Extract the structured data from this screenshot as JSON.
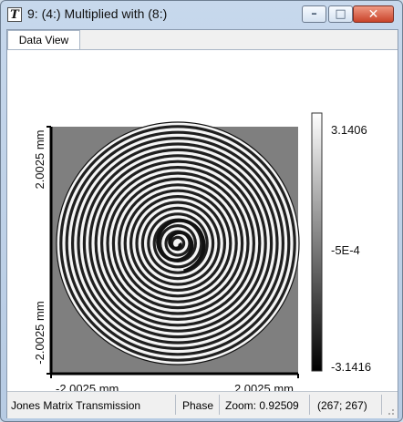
{
  "window": {
    "icon_letter": "T",
    "title": "9: (4:) Multiplied with (8:)",
    "buttons": [
      "minimize",
      "maximize",
      "close"
    ]
  },
  "tabs": [
    {
      "label": "Data View"
    }
  ],
  "view": {
    "y_axis": {
      "top_label": "2.0025 mm",
      "bottom_label": "-2.0025 mm"
    },
    "x_axis": {
      "left_label": "-2.0025 mm",
      "right_label": "2.0025 mm"
    },
    "colorbar": {
      "max": "3.1406",
      "mid": "-5E-4",
      "min": "-3.1416",
      "colormap": "grayscale"
    },
    "image": {
      "type": "phase spiral",
      "background": "#7f7f7f",
      "aperture": "circular"
    }
  },
  "status": {
    "mode": "Jones Matrix Transmission",
    "quantity": "Phase",
    "zoom": "Zoom: 0.92509",
    "coords": "(267; 267)"
  },
  "colors": {
    "accent": "#c9432a",
    "frame": "#b7cbe3"
  }
}
